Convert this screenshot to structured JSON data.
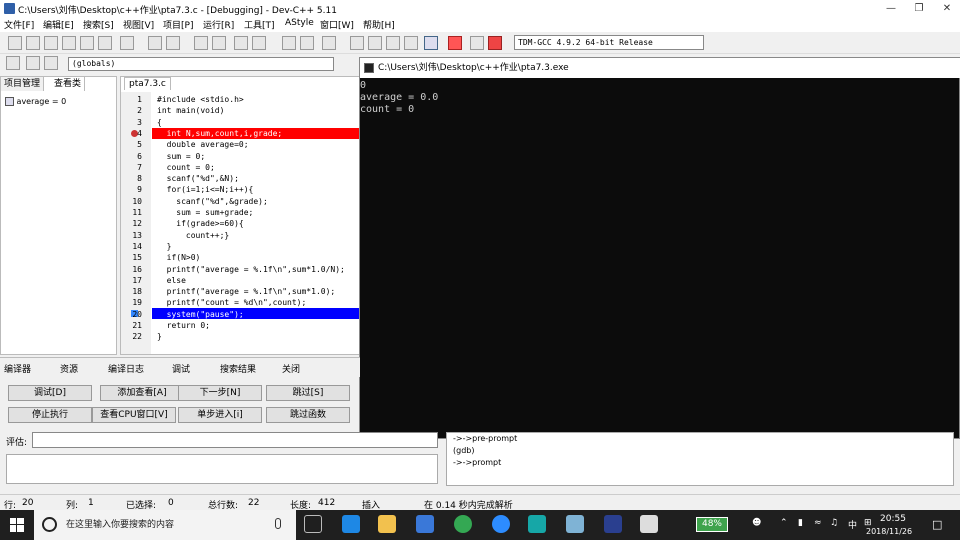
{
  "window": {
    "title": "C:\\Users\\刘伟\\Desktop\\c++作业\\pta7.3.c - [Debugging] - Dev-C++ 5.11",
    "min": "—",
    "max": "❐",
    "close": "✕"
  },
  "menu": [
    "文件[F]",
    "编辑[E]",
    "搜索[S]",
    "视图[V]",
    "项目[P]",
    "运行[R]",
    "工具[T]",
    "AStyle",
    "窗口[W]",
    "帮助[H]"
  ],
  "compiler": "TDM-GCC 4.9.2 64-bit Release",
  "globals": "(globals)",
  "left_tabs": [
    "项目管理",
    "查看类"
  ],
  "tree_item": "average = 0",
  "file_tab": "pta7.3.c",
  "lines": [
    "#include <stdio.h>",
    "int main(void)",
    "{",
    "  int N,sum,count,i,grade;",
    "  double average=0;",
    "  sum = 0;",
    "  count = 0;",
    "  scanf(\"%d\",&N);",
    "  for(i=1;i<=N;i++){",
    "    scanf(\"%d\",&grade);",
    "    sum = sum+grade;",
    "    if(grade>=60){",
    "      count++;}",
    "  }",
    "  if(N>0)",
    "  printf(\"average = %.1f\\n\",sum*1.0/N);",
    "  else",
    "  printf(\"average = %.1f\\n\",sum*1.0);",
    "  printf(\"count = %d\\n\",count);",
    "  system(\"pause\");",
    "  return 0;",
    "}"
  ],
  "line_numbers": [
    "1",
    "2",
    "3",
    "4",
    "5",
    "6",
    "7",
    "8",
    "9",
    "10",
    "11",
    "12",
    "13",
    "14",
    "15",
    "16",
    "17",
    "18",
    "19",
    "20",
    "21",
    "22"
  ],
  "console": {
    "title": "C:\\Users\\刘伟\\Desktop\\c++作业\\pta7.3.exe",
    "output": "0\naverage = 0.0\ncount = 0"
  },
  "bottom_tabs": [
    "编译器",
    "资源",
    "编译日志",
    "调试",
    "搜索结果",
    "关闭"
  ],
  "debug_buttons": [
    "调试[D]",
    "添加查看[A]",
    "下一步[N]",
    "跳过[S]",
    "停止执行",
    "查看CPU窗口[V]",
    "单步进入[i]",
    "跳过函数"
  ],
  "eval_label": "评估:",
  "gdb_lines": [
    "->->pre-prompt",
    "(gdb)",
    "->->prompt"
  ],
  "status": {
    "row_label": "行:",
    "row": "20",
    "col_label": "列:",
    "col": "1",
    "sel_label": "已选择:",
    "sel": "0",
    "total_label": "总行数:",
    "total": "22",
    "len_label": "长度:",
    "len": "412",
    "mode": "插入",
    "msg": "在 0.14 秒内完成解析"
  },
  "taskbar": {
    "search_placeholder": "在这里输入你要搜索的内容",
    "battery": "48%",
    "ime": "中",
    "time": "20:55",
    "date": "2018/11/26"
  }
}
